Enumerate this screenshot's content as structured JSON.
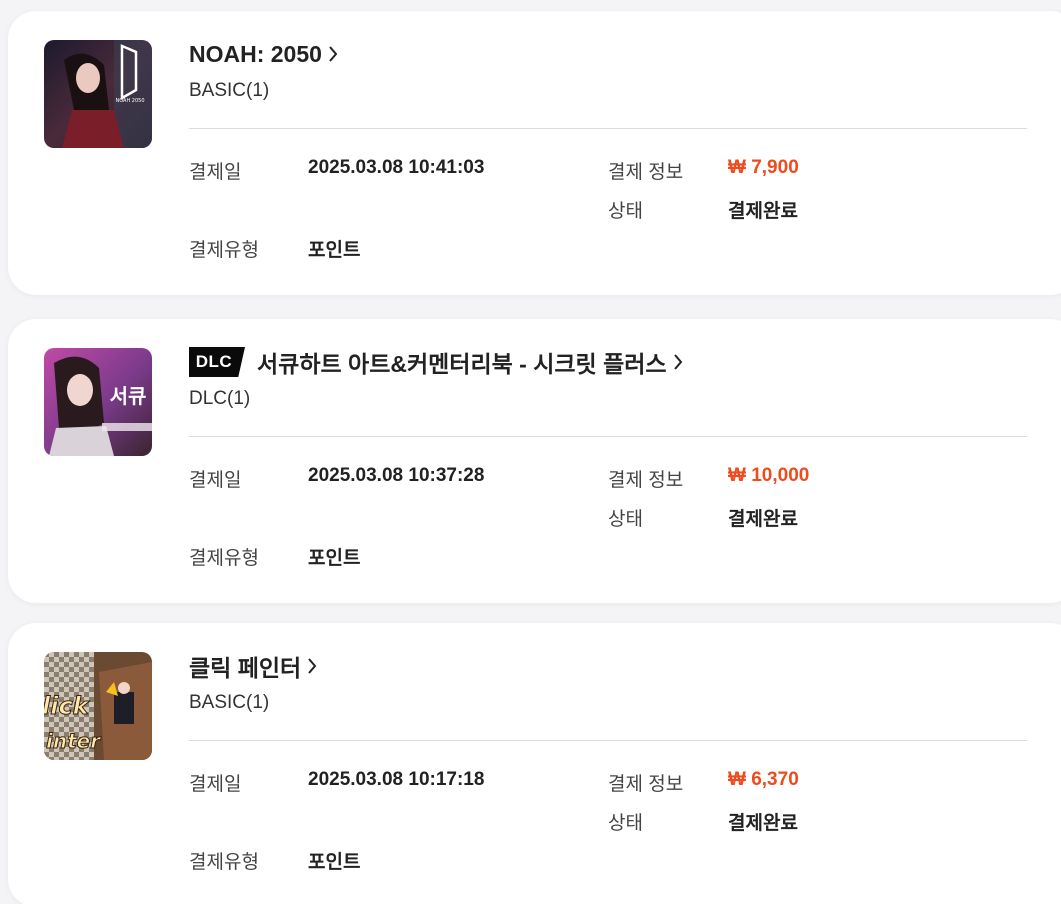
{
  "labels": {
    "payment_date": "결제일",
    "payment_info": "결제 정보",
    "status": "상태",
    "payment_type": "결제유형"
  },
  "orders": [
    {
      "title": "NOAH: 2050",
      "badge": "",
      "product": "BASIC(1)",
      "payment_date": "2025.03.08 10:41:03",
      "price": "₩ 7,900",
      "status": "결제완료",
      "payment_type": "포인트"
    },
    {
      "title": "서큐하트 아트&커멘터리북 - 시크릿 플러스",
      "badge": "DLC",
      "product": "DLC(1)",
      "payment_date": "2025.03.08 10:37:28",
      "price": "₩ 10,000",
      "status": "결제완료",
      "payment_type": "포인트"
    },
    {
      "title": "클릭 페인터",
      "badge": "",
      "product": "BASIC(1)",
      "payment_date": "2025.03.08 10:17:18",
      "price": "₩ 6,370",
      "status": "결제완료",
      "payment_type": "포인트"
    }
  ],
  "thumbnail_art": {
    "noah": {
      "logo_text": "NOAH 2050"
    },
    "succubus": {
      "logo_text": "서큐"
    },
    "click": {
      "logo_line1": "lick",
      "logo_line2": "inter"
    }
  },
  "colors": {
    "price": "#f04a1d",
    "card_background": "#ffffff",
    "page_background": "#f4f4f6",
    "badge_background": "#0a0a0a"
  }
}
